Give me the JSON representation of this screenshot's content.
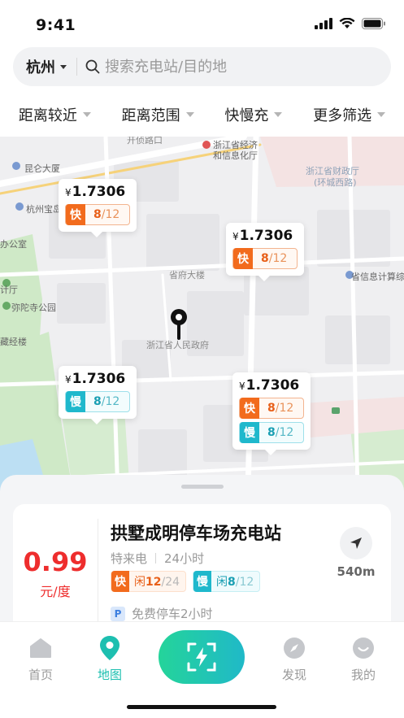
{
  "status_bar": {
    "time": "9:41"
  },
  "search": {
    "city": "杭州",
    "placeholder": "搜索充电站/目的地"
  },
  "filters": [
    "距离较近",
    "距离范围",
    "快慢充",
    "更多筛选"
  ],
  "map": {
    "labels": [
      "开侦路口",
      "浙江省经济",
      "和信息化厅",
      "浙江省财政厅",
      "(环城西路)",
      "昆仑大厦",
      "杭州宝岛",
      "办公室",
      "计厅",
      "弥陀寺公园",
      "藏经楼",
      "省府大楼",
      "浙江省人民政府",
      "省信息计算综合"
    ],
    "stations": [
      {
        "price_symbol": "¥",
        "price": "1.7306",
        "chips": [
          {
            "type": "fast",
            "tag": "快",
            "free": "8",
            "total": "/12"
          }
        ]
      },
      {
        "price_symbol": "¥",
        "price": "1.7306",
        "chips": [
          {
            "type": "fast",
            "tag": "快",
            "free": "8",
            "total": "/12"
          }
        ]
      },
      {
        "price_symbol": "¥",
        "price": "1.7306",
        "chips": [
          {
            "type": "slow",
            "tag": "慢",
            "free": "8",
            "total": "/12"
          }
        ]
      },
      {
        "price_symbol": "¥",
        "price": "1.7306",
        "chips": [
          {
            "type": "fast",
            "tag": "快",
            "free": "8",
            "total": "/12"
          },
          {
            "type": "slow",
            "tag": "慢",
            "free": "8",
            "total": "/12"
          }
        ]
      }
    ]
  },
  "station_card": {
    "price": "0.99",
    "unit": "元/度",
    "name": "拱墅成明停车场充电站",
    "operator": "特来电",
    "hours": "24小时",
    "fast": {
      "tag": "快",
      "label": "闲",
      "free": "12",
      "total": "/24"
    },
    "slow": {
      "tag": "慢",
      "label": "闲",
      "free": "8",
      "total": "/12"
    },
    "parking_icon": "P",
    "parking": "免费停车2小时",
    "distance": "540m"
  },
  "tabbar": {
    "home": "首页",
    "map": "地图",
    "discover": "发现",
    "mine": "我的"
  },
  "colors": {
    "accent": "#1dbfb0",
    "fast": "#f26b1d",
    "slow": "#1fb8cc",
    "price": "#ee2d2d"
  }
}
